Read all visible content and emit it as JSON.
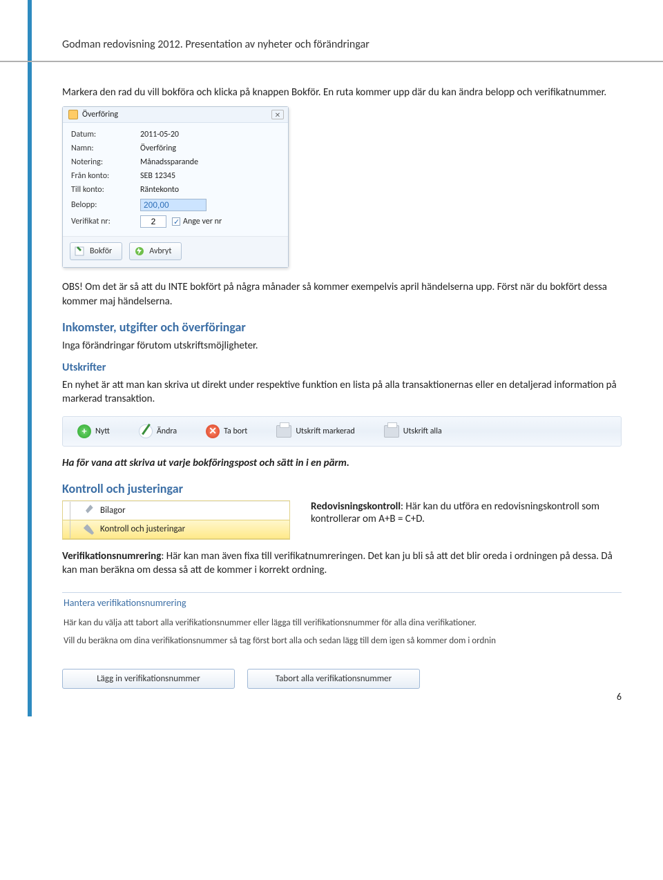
{
  "header": "Godman redovisning 2012. Presentation av  nyheter och förändringar",
  "intro1": "Markera den rad du vill bokföra och klicka på knappen Bokför. En ruta kommer upp där du kan ändra belopp och verifikatnummer.",
  "dialog": {
    "title": "Överföring",
    "rows": {
      "datum_l": "Datum:",
      "datum_v": "2011-05-20",
      "namn_l": "Namn:",
      "namn_v": "Överföring",
      "notering_l": "Notering:",
      "notering_v": "Månadssparande",
      "fran_l": "Från konto:",
      "fran_v": "SEB 12345",
      "till_l": "Till konto:",
      "till_v": "Räntekonto",
      "belopp_l": "Belopp:",
      "belopp_v": "200,00",
      "verif_l": "Verifikat nr:",
      "verif_v": "2",
      "angevernr": "Ange ver nr"
    },
    "ok": "Bokför",
    "cancel": "Avbryt"
  },
  "obs": "OBS! Om det är så att du INTE bokfört på några månader så kommer exempelvis april händelserna upp. Först när du bokfört dessa kommer maj händelserna.",
  "h_inkomster": "Inkomster, utgifter och överföringar",
  "p_inga": "Inga förändringar förutom utskriftsmöjligheter.",
  "h_utskrifter": "Utskrifter",
  "p_utskrifter": "En nyhet är att man kan skriva ut direkt under respektive funktion en lista på alla transaktionernas eller en detaljerad information på markerad transaktion.",
  "toolbar": {
    "nytt": "Nytt",
    "andra": "Ändra",
    "tabort": "Ta bort",
    "utskrift_markerad": "Utskrift markerad",
    "utskrift_alla": "Utskrift alla"
  },
  "p_havana": "Ha för vana att skriva ut varje bokföringspost och sätt in i en pärm.",
  "h_kontroll": "Kontroll och justeringar",
  "tree": {
    "bilagor": "Bilagor",
    "kontroll": "Kontroll och justeringar"
  },
  "redov_label": "Redovisningskontroll",
  "redov_rest": ": Här kan du utföra en redovisningskontroll som kontrollerar om A+B = C+D.",
  "verif_label": "Verifikationsnumrering",
  "verif_rest": ": Här kan man även fixa till verifikatnumreringen. Det kan ju bli så att det blir oreda i ordningen på dessa. Då kan man beräkna om dessa så att de kommer i korrekt ordning.",
  "hantera": {
    "title": "Hantera verifikationsnumrering",
    "line1": "Här kan du välja att tabort alla verifikationsnummer eller lägga till verifikationsnummer för alla dina verifikationer.",
    "line2": "Vill du beräkna om dina verifikationsnummer så tag först bort alla och sedan lägg till dem igen så kommer dom i ordnin",
    "btn1": "Lägg in verifikationsnummer",
    "btn2": "Tabort alla verifikationsnummer"
  },
  "page_num": "6"
}
